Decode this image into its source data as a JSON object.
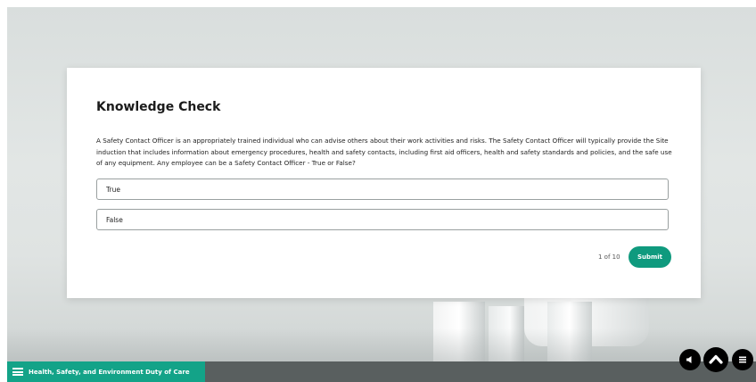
{
  "card": {
    "title": "Knowledge Check",
    "question": "A Safety Contact Officer is an appropriately trained individual who can advise others about their work activities and risks. The Safety Contact Officer will typically provide the Site induction that includes information about emergency procedures, health and safety contacts, including first aid officers, health and safety standards and policies, and the safe use of any equipment. Any employee can be a Safety Contact Officer - True or False?",
    "options": [
      {
        "label": "True"
      },
      {
        "label": "False"
      }
    ],
    "counter": "1 of 10",
    "submit_label": "Submit"
  },
  "footer": {
    "course_title": "Health, Safety, and Environment Duty of Care",
    "icons": {
      "menu": "hamburger-menu-icon",
      "audio": "speaker-icon",
      "scroll_up": "chevron-up-icon",
      "list": "list-menu-icon"
    }
  },
  "colors": {
    "accent": "#13a388",
    "submit": "#0f9a7e",
    "footer_bar": "#595f5f"
  }
}
